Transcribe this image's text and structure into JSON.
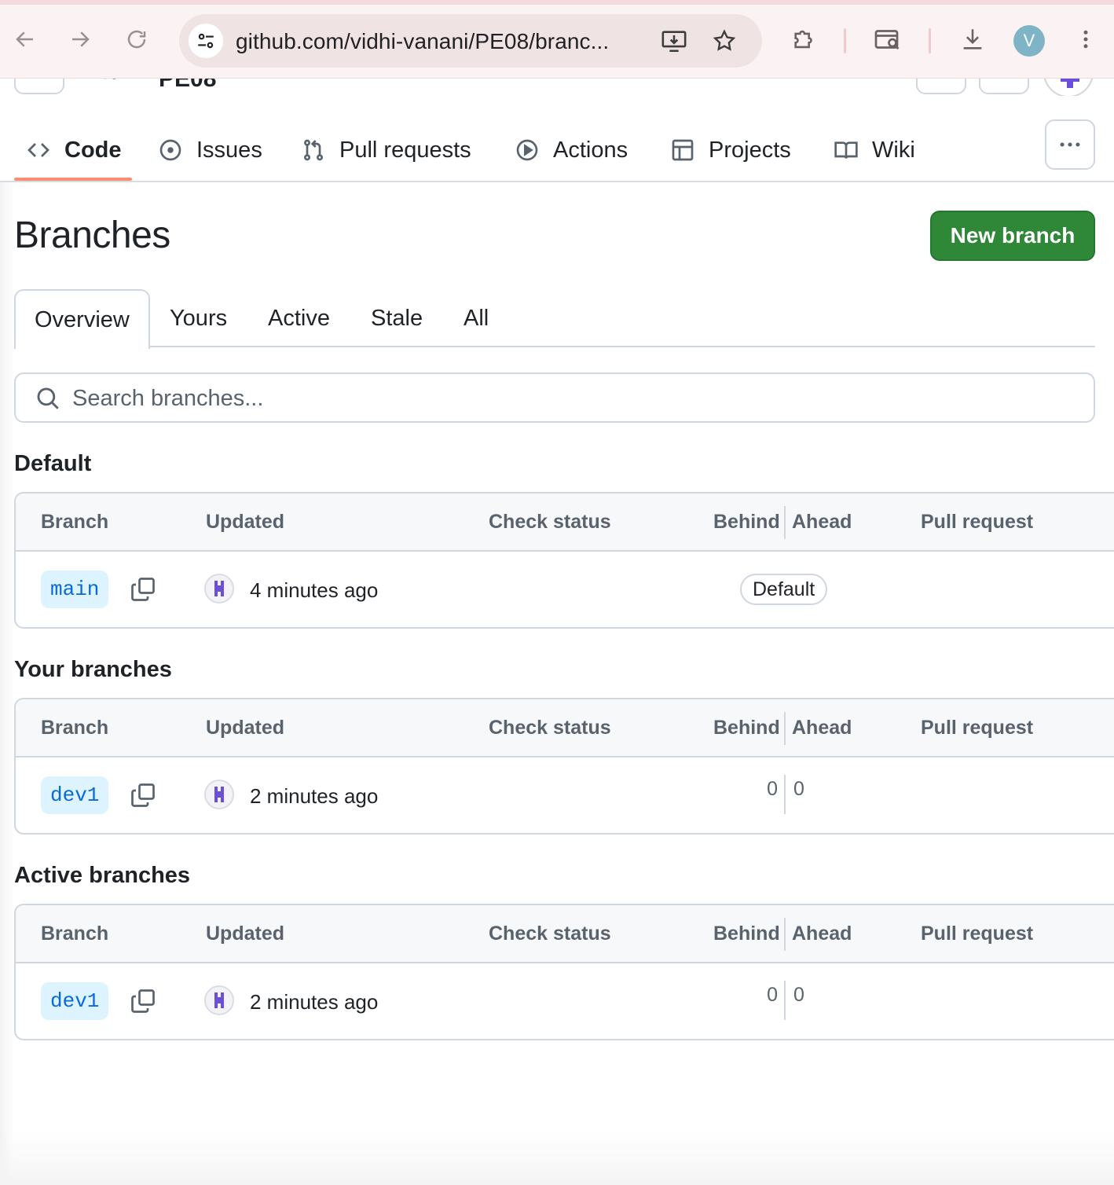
{
  "browser": {
    "url": "github.com/vidhi-vanani/PE08/branc...",
    "profile_initial": "V"
  },
  "repo": {
    "name": "PE08"
  },
  "repo_nav": {
    "items": [
      {
        "label": "Code",
        "icon": "code-icon",
        "active": true
      },
      {
        "label": "Issues",
        "icon": "issue-opened-icon"
      },
      {
        "label": "Pull requests",
        "icon": "git-pull-request-icon"
      },
      {
        "label": "Actions",
        "icon": "play-icon"
      },
      {
        "label": "Projects",
        "icon": "table-icon"
      },
      {
        "label": "Wiki",
        "icon": "book-icon"
      }
    ],
    "more_icon": "kebab-horizontal-icon"
  },
  "page": {
    "title": "Branches",
    "new_branch_label": "New branch"
  },
  "tabs": [
    "Overview",
    "Yours",
    "Active",
    "Stale",
    "All"
  ],
  "search": {
    "placeholder": "Search branches..."
  },
  "columns": {
    "branch": "Branch",
    "updated": "Updated",
    "check_status": "Check status",
    "behind": "Behind",
    "ahead": "Ahead",
    "pull_request": "Pull request"
  },
  "sections": [
    {
      "title": "Default",
      "rows": [
        {
          "branch": "main",
          "updated": "4 minutes ago",
          "badge": "Default"
        }
      ]
    },
    {
      "title": "Your branches",
      "rows": [
        {
          "branch": "dev1",
          "updated": "2 minutes ago",
          "behind": "0",
          "ahead": "0"
        }
      ]
    },
    {
      "title": "Active branches",
      "rows": [
        {
          "branch": "dev1",
          "updated": "2 minutes ago",
          "behind": "0",
          "ahead": "0"
        }
      ]
    }
  ],
  "colors": {
    "primary_button": "#2e8838",
    "branch_pill_bg": "#ddf4ff",
    "branch_pill_text": "#0969da",
    "nav_underline": "#fd8c73"
  }
}
